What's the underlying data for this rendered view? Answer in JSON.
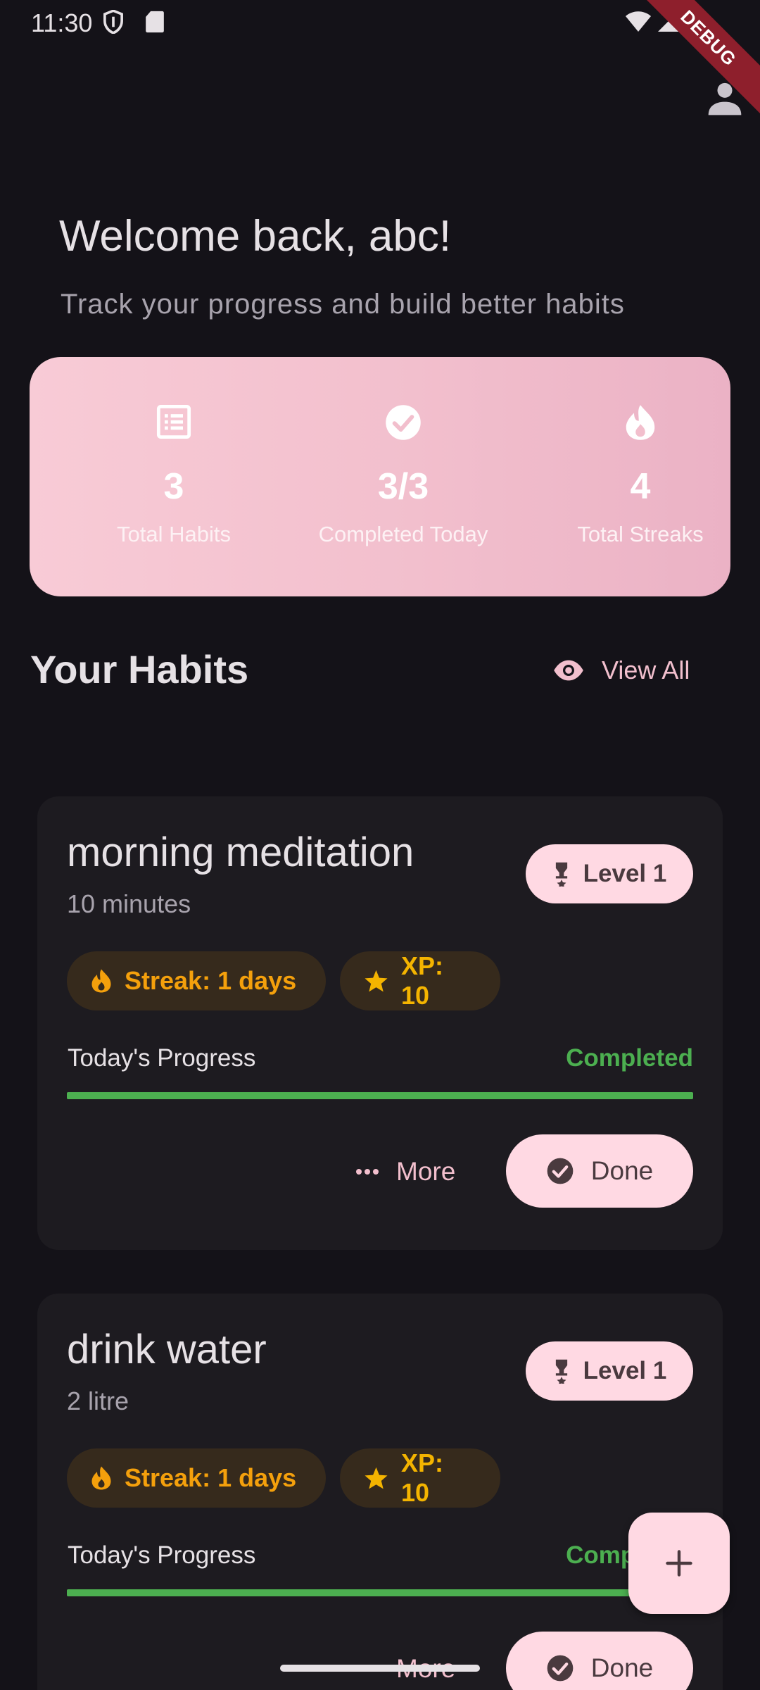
{
  "status_bar": {
    "time": "11:30",
    "debug_label": "DEBUG"
  },
  "header": {
    "welcome": "Welcome back, abc!",
    "subtitle": "Track your progress and build better habits"
  },
  "stats": [
    {
      "icon": "list-icon",
      "value": "3",
      "label": "Total Habits"
    },
    {
      "icon": "check-circle-icon",
      "value": "3/3",
      "label": "Completed Today"
    },
    {
      "icon": "flame-icon",
      "value": "4",
      "label": "Total Streaks"
    }
  ],
  "habits_section": {
    "title": "Your Habits",
    "view_all": "View All"
  },
  "habits": [
    {
      "name": "morning meditation",
      "description": "10 minutes",
      "level": "Level 1",
      "streak": "Streak: 1 days",
      "xp": "XP: 10",
      "progress_label": "Today's Progress",
      "progress_status": "Completed",
      "progress": 1.0,
      "more_label": "More",
      "done_label": "Done"
    },
    {
      "name": "drink water",
      "description": "2 litre",
      "level": "Level 1",
      "streak": "Streak: 1 days",
      "xp": "XP: 10",
      "progress_label": "Today's Progress",
      "progress_status": "Completed",
      "progress": 1.0,
      "more_label": "More",
      "done_label": "Done"
    }
  ],
  "colors": {
    "background": "#141218",
    "card": "#1d1b20",
    "accent_pink": "#ffd9e3",
    "streak_orange": "#f4a00c",
    "success_green": "#4caf50"
  }
}
